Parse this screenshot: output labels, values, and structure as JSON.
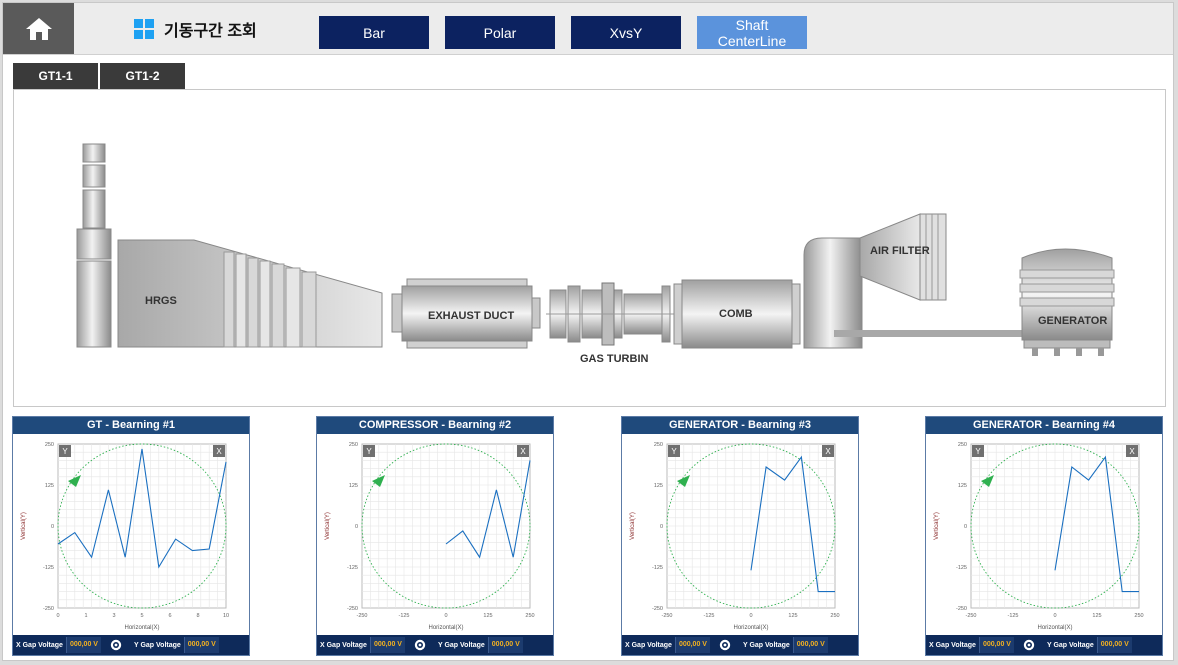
{
  "header": {
    "title": "기동구간 조회",
    "buttons": [
      "Bar",
      "Polar",
      "XvsY",
      "Shaft CenterLine"
    ],
    "active_button": "Shaft CenterLine"
  },
  "tabs": [
    "GT1-1",
    "GT1-2"
  ],
  "diagram": {
    "labels": {
      "hrgs": "HRGS",
      "exhaust": "EXHAUST DUCT",
      "gas": "GAS TURBIN",
      "comb": "COMB",
      "air": "AIR FILTER",
      "gen": "GENERATOR"
    }
  },
  "footer_labels": {
    "x": "X Gap Voltage",
    "y": "Y Gap Voltage"
  },
  "axis_text": {
    "x_title": "Horizontal(X)",
    "y_title": "Vertical(Y)",
    "y_badge": "Y",
    "x_badge": "X"
  },
  "colors": {
    "nav": "#0c2260",
    "active": "#5b93dc",
    "panel_head": "#1f4a7c",
    "line": "#1a6fc0",
    "circle": "#2fb04f",
    "value": "#f2b020"
  },
  "panels": [
    {
      "title": "GT - Bearning #1",
      "x_gap": "000,00 V",
      "y_gap": "000,00 V",
      "chart_data": {
        "type": "line",
        "xlim": [
          0,
          10
        ],
        "ylim": [
          -250,
          250
        ],
        "x_ticks": [
          "0",
          "1",
          "3",
          "5",
          "6",
          "8",
          "10"
        ],
        "y_ticks": [
          "250",
          "125",
          "0",
          "-125",
          "-250"
        ],
        "xlabel": "Horizontal(X)",
        "ylabel": "Vertical(Y)",
        "series": [
          {
            "x": [
              0,
              1,
              2,
              3,
              4,
              5,
              6,
              7,
              8,
              9,
              10
            ],
            "y": [
              -55,
              -20,
              -95,
              110,
              -95,
              235,
              -125,
              -40,
              -75,
              -70,
              195
            ]
          }
        ]
      }
    },
    {
      "title": "COMPRESSOR - Bearning #2",
      "x_gap": "000,00 V",
      "y_gap": "000,00 V",
      "chart_data": {
        "type": "line",
        "xlim": [
          -250,
          250
        ],
        "ylim": [
          -250,
          250
        ],
        "x_ticks": [
          "-250",
          "-125",
          "0",
          "125",
          "250"
        ],
        "y_ticks": [
          "250",
          "125",
          "0",
          "-125",
          "-250"
        ],
        "xlabel": "Horizontal(X)",
        "ylabel": "Vertical(Y)",
        "series": [
          {
            "x": [
              0,
              50,
              100,
              150,
              200,
              250
            ],
            "y": [
              -55,
              -15,
              -95,
              110,
              -95,
              200
            ]
          }
        ]
      }
    },
    {
      "title": "GENERATOR - Bearning #3",
      "x_gap": "000,00 V",
      "y_gap": "000,00 V",
      "chart_data": {
        "type": "line",
        "xlim": [
          -250,
          250
        ],
        "ylim": [
          -250,
          250
        ],
        "x_ticks": [
          "-250",
          "-125",
          "0",
          "125",
          "250"
        ],
        "y_ticks": [
          "250",
          "125",
          "0",
          "-125",
          "-250"
        ],
        "xlabel": "Horizontal(X)",
        "ylabel": "Vertical(Y)",
        "series": [
          {
            "x": [
              0,
              45,
              100,
              150,
              200,
              250
            ],
            "y": [
              -135,
              180,
              140,
              210,
              -200,
              -200
            ]
          }
        ]
      }
    },
    {
      "title": "GENERATOR - Bearning #4",
      "x_gap": "000,00 V",
      "y_gap": "000,00 V",
      "chart_data": {
        "type": "line",
        "xlim": [
          -250,
          250
        ],
        "ylim": [
          -250,
          250
        ],
        "x_ticks": [
          "-250",
          "-125",
          "0",
          "125",
          "250"
        ],
        "y_ticks": [
          "250",
          "125",
          "0",
          "-125",
          "-250"
        ],
        "xlabel": "Horizontal(X)",
        "ylabel": "Vertical(Y)",
        "series": [
          {
            "x": [
              0,
              50,
              100,
              150,
              200,
              250
            ],
            "y": [
              -135,
              180,
              140,
              210,
              -200,
              -200
            ]
          }
        ]
      }
    }
  ]
}
